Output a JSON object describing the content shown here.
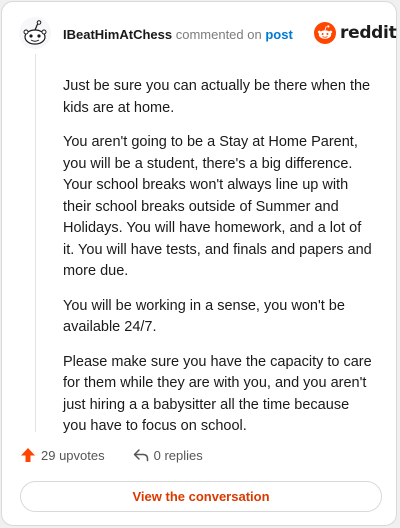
{
  "comment": {
    "username": "IBeatHimAtChess",
    "action_text": "commented on",
    "post_link": "post",
    "brand": "reddit",
    "paragraphs": [
      "Just be sure you can actually be there when the kids are at home.",
      "You aren't going to be a Stay at Home Parent, you will be a student, there's a big difference. Your school breaks won't always line up with their school breaks outside of Summer and Holidays. You will have homework, and a lot of it. You will have tests, and finals and papers and more due.",
      "You will be working in a sense, you won't be available 24/7.",
      "Please make sure you have the capacity to care for them while they are with you, and you aren't just hiring a a babysitter all the time because you have to focus on school."
    ]
  },
  "actions": {
    "upvotes": "29 upvotes",
    "replies": "0 replies",
    "view_conversation": "View the conversation"
  },
  "icons": {
    "avatar": "snoo-avatar-icon",
    "logo": "reddit-logo-icon",
    "upvote": "upvote-arrow-icon",
    "reply": "reply-arrow-icon"
  },
  "colors": {
    "brand_orange": "#ff4500",
    "upvote": "#ff4500",
    "link_blue": "#0079d3",
    "button_text": "#d93a00"
  }
}
